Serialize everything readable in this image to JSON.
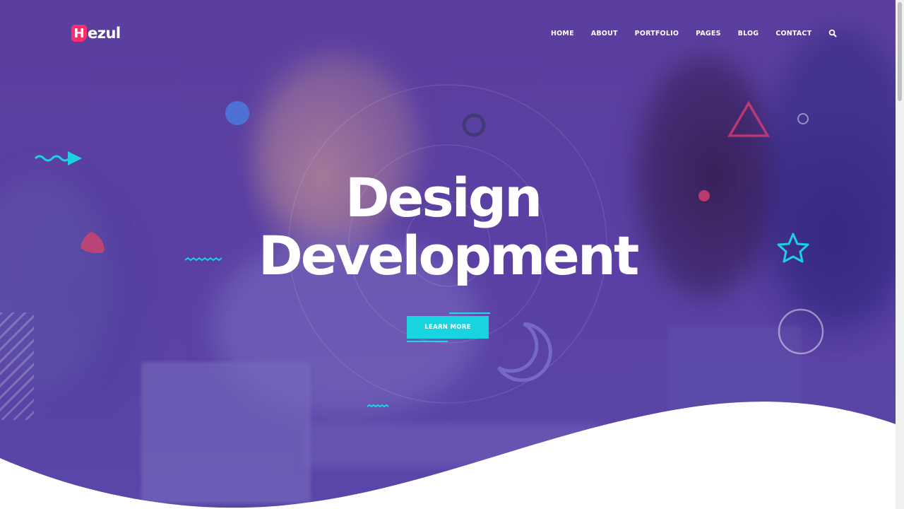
{
  "brand": {
    "logo_letter": "H",
    "logo_text": "ezul",
    "accent": "#ff2d6a"
  },
  "nav": {
    "items": [
      "HOME",
      "ABOUT",
      "PORTFOLIO",
      "PAGES",
      "BLOG",
      "CONTACT"
    ],
    "search_icon": "search-icon"
  },
  "hero": {
    "title_line1": "Design",
    "title_line2": "Development",
    "cta_label": "LEARN MORE",
    "cta_color": "#18d4e0",
    "overlay_color": "#5a40a4"
  }
}
